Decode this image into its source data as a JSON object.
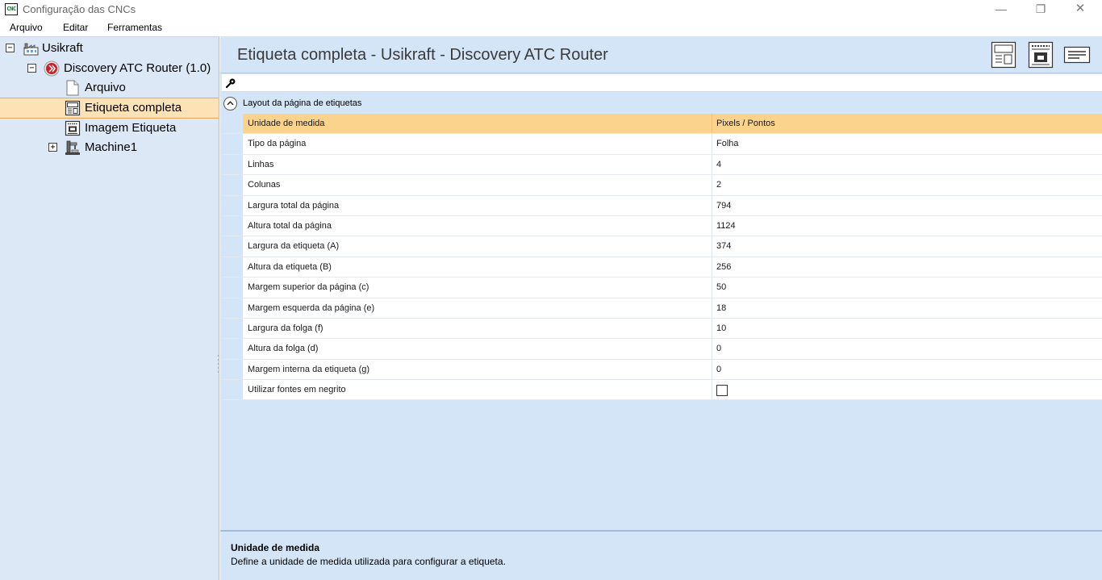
{
  "window": {
    "title": "Configuração das CNCs",
    "app_icon_text": "CNC"
  },
  "menu": {
    "items": [
      "Arquivo",
      "Editar",
      "Ferramentas"
    ]
  },
  "tree": {
    "root": "Usikraft",
    "router": "Discovery ATC Router (1.0)",
    "items": [
      "Arquivo",
      "Etiqueta completa",
      "Imagem Etiqueta"
    ],
    "machine": "Machine1",
    "selected": "Etiqueta completa"
  },
  "header": {
    "title": "Etiqueta completa - Usikraft - Discovery ATC Router"
  },
  "search": {
    "placeholder": "",
    "value": ""
  },
  "group": {
    "title": "Layout da página de etiquetas"
  },
  "properties": [
    {
      "name": "Unidade de medida",
      "value": "Pixels / Pontos",
      "selected": true
    },
    {
      "name": "Tipo da página",
      "value": "Folha"
    },
    {
      "name": "Linhas",
      "value": "4"
    },
    {
      "name": "Colunas",
      "value": "2"
    },
    {
      "name": "Largura total da página",
      "value": "794"
    },
    {
      "name": "Altura total da página",
      "value": "1124"
    },
    {
      "name": "Largura da etiqueta (A)",
      "value": "374"
    },
    {
      "name": "Altura da etiqueta (B)",
      "value": "256"
    },
    {
      "name": "Margem superior da página (c)",
      "value": "50"
    },
    {
      "name": "Margem esquerda da página (e)",
      "value": "18"
    },
    {
      "name": "Largura da folga (f)",
      "value": "10"
    },
    {
      "name": "Altura da folga (d)",
      "value": "0"
    },
    {
      "name": "Margem interna da etiqueta (g)",
      "value": "0"
    },
    {
      "name": "Utilizar fontes em negrito",
      "value": "",
      "checkbox": true,
      "checked": false
    }
  ],
  "description": {
    "title": "Unidade de medida",
    "text": "Define a unidade de medida utilizada para configurar a etiqueta."
  },
  "colors": {
    "selection": "#fcd38c",
    "tree_selection": "#fde2b5",
    "panel_bg": "#d5e5f8",
    "tree_bg": "#dde8f6"
  }
}
